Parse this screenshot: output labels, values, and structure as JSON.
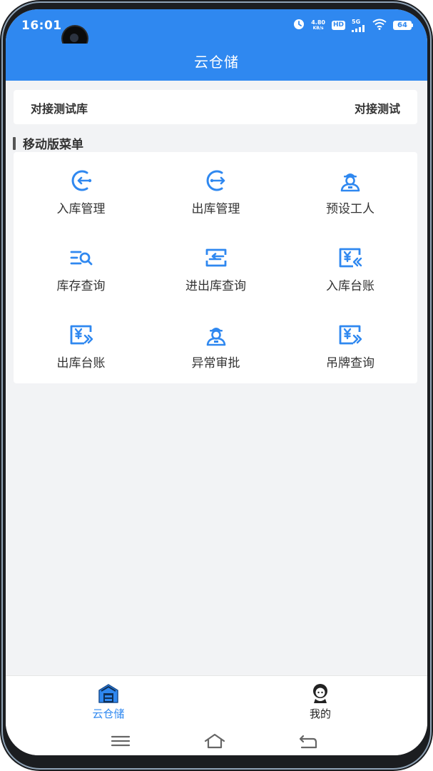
{
  "status_bar": {
    "time": "16:01",
    "net_speed_value": "4.80",
    "net_speed_unit": "KB/s",
    "hd_badge": "HD",
    "signal_label": "5G",
    "battery_level": "64",
    "icons": [
      "alarm-icon",
      "hd-icon",
      "5g-signal-icon",
      "wifi-icon",
      "battery-icon"
    ]
  },
  "header": {
    "title": "云仓储"
  },
  "warehouse": {
    "left_label": "对接测试库",
    "right_label": "对接测试"
  },
  "section": {
    "title": "移动版菜单"
  },
  "menu": {
    "items": [
      {
        "label": "入库管理",
        "icon": "inbound-icon"
      },
      {
        "label": "出库管理",
        "icon": "outbound-icon"
      },
      {
        "label": "预设工人",
        "icon": "worker-icon"
      },
      {
        "label": "库存查询",
        "icon": "inventory-search-icon"
      },
      {
        "label": "进出库查询",
        "icon": "transfer-icon"
      },
      {
        "label": "入库台账",
        "icon": "inbound-ledger-icon"
      },
      {
        "label": "出库台账",
        "icon": "outbound-ledger-icon"
      },
      {
        "label": "异常审批",
        "icon": "worker-icon"
      },
      {
        "label": "吊牌查询",
        "icon": "tag-ledger-icon"
      }
    ]
  },
  "tabbar": {
    "items": [
      {
        "label": "云仓储",
        "icon": "warehouse-icon",
        "active": true
      },
      {
        "label": "我的",
        "icon": "profile-icon",
        "active": false
      }
    ]
  },
  "nav": {
    "buttons": [
      "menu-icon",
      "home-icon",
      "back-icon"
    ]
  },
  "colors": {
    "primary": "#2f88f0",
    "background": "#f2f3f5",
    "text": "#333333"
  }
}
